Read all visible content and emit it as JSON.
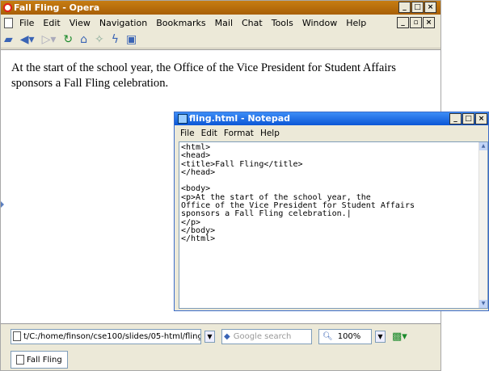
{
  "opera": {
    "title": "Fall Fling - Opera",
    "menu": [
      "File",
      "Edit",
      "View",
      "Navigation",
      "Bookmarks",
      "Mail",
      "Chat",
      "Tools",
      "Window",
      "Help"
    ],
    "content": "At the start of the school year, the Office of the Vice President for Student Affairs sponsors a Fall Fling celebration.",
    "address": "t/C:/home/finson/cse100/slides/05-html/fling",
    "search_placeholder": "Google search",
    "zoom": "100%",
    "tab_label": "Fall Fling"
  },
  "notepad": {
    "title": "fling.html - Notepad",
    "menu": [
      "File",
      "Edit",
      "Format",
      "Help"
    ],
    "text": "<html>\n<head>\n<title>Fall Fling</title>\n</head>\n\n<body>\n<p>At the start of the school year, the\nOffice of the Vice President for Student Affairs\nsponsors a Fall Fling celebration.|\n</p>\n</body>\n</html>"
  }
}
